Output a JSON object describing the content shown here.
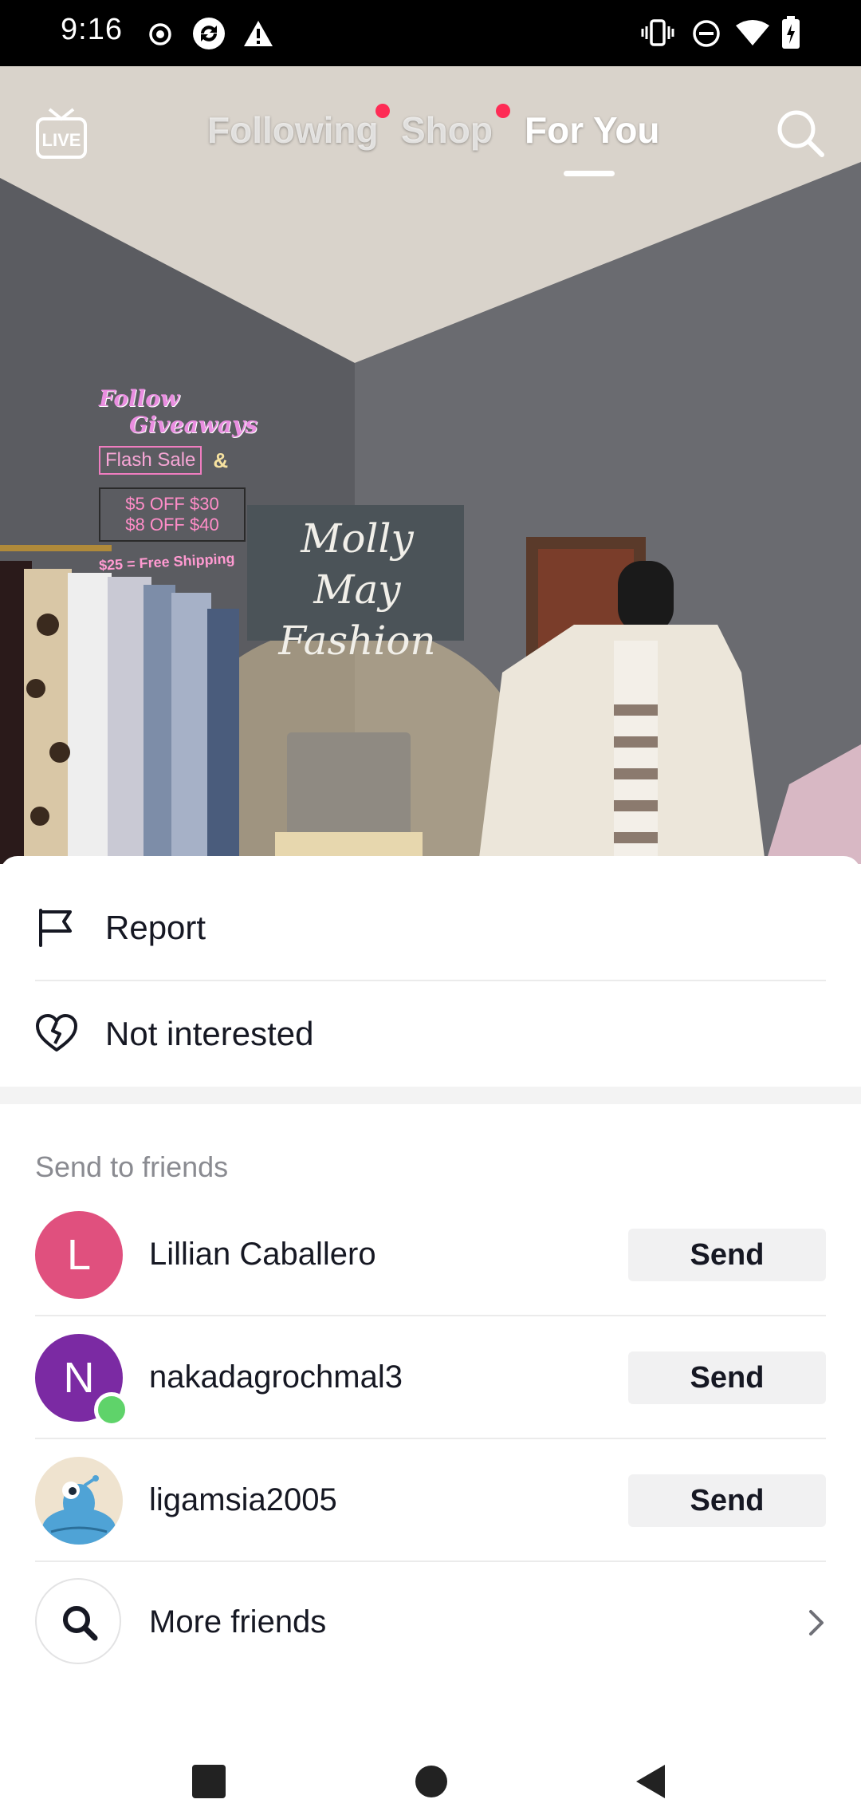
{
  "status_bar": {
    "time": "9:16",
    "left_icons": [
      "record-icon",
      "sync-icon",
      "warning-icon"
    ],
    "right_icons": [
      "vibrate-icon",
      "do-not-disturb-icon",
      "wifi-icon",
      "battery-icon"
    ]
  },
  "top_nav": {
    "live_label": "LIVE",
    "tabs": [
      {
        "label": "Following",
        "has_dot": true,
        "active": false
      },
      {
        "label": "Shop",
        "has_dot": true,
        "active": false
      },
      {
        "label": "For You",
        "has_dot": false,
        "active": true
      }
    ],
    "accent_color": "#fe2c55"
  },
  "video": {
    "overlay_lines": [
      "Follow",
      "Giveaways",
      "Flash Sale",
      "&",
      "$5 OFF $30",
      "$8 OFF $40",
      "$25 = Free Shipping"
    ],
    "sign_text": [
      "Molly May",
      "Fashion"
    ]
  },
  "sheet": {
    "actions": [
      {
        "label": "Report",
        "icon": "flag-icon"
      },
      {
        "label": "Not interested",
        "icon": "broken-heart-icon"
      }
    ],
    "send_section_title": "Send to friends",
    "friends": [
      {
        "name": "Lillian Caballero",
        "initial": "L",
        "avatar_color": "#e0507e",
        "online": false,
        "button": "Send"
      },
      {
        "name": "nakadagrochmal3",
        "initial": "N",
        "avatar_color": "#7b2aa3",
        "online": true,
        "button": "Send"
      },
      {
        "name": "ligamsia2005",
        "initial": "",
        "avatar_color": "#efe3cf",
        "online": false,
        "button": "Send"
      }
    ],
    "more_friends_label": "More friends"
  },
  "nav_bar": {
    "buttons": [
      "recents-button",
      "home-button",
      "back-button"
    ]
  }
}
